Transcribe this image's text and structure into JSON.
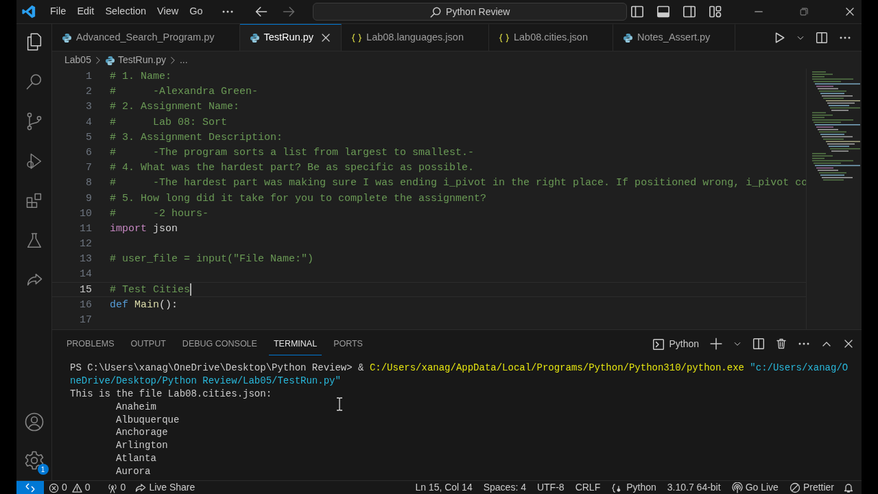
{
  "menu": [
    "File",
    "Edit",
    "Selection",
    "View",
    "Go"
  ],
  "command_center": {
    "text": "Python Review"
  },
  "tabs": [
    {
      "label": "Advanced_Search_Program.py",
      "kind": "python",
      "selected": false
    },
    {
      "label": "TestRun.py",
      "kind": "python",
      "selected": true
    },
    {
      "label": "Lab08.languages.json",
      "kind": "json",
      "selected": false
    },
    {
      "label": "Lab08.cities.json",
      "kind": "json",
      "selected": false
    },
    {
      "label": "Notes_Assert.py",
      "kind": "python",
      "selected": false
    }
  ],
  "breadcrumbs": [
    {
      "text": "Lab05",
      "kind": "folder"
    },
    {
      "text": "TestRun.py",
      "kind": "python"
    },
    {
      "text": "...",
      "kind": "more"
    }
  ],
  "code": [
    {
      "number": "1",
      "current": false,
      "tokens": [
        {
          "text": "# 1. Name:",
          "kind": "comment"
        }
      ]
    },
    {
      "number": "2",
      "current": false,
      "tokens": [
        {
          "text": "#      -Alexandra Green-",
          "kind": "comment"
        }
      ]
    },
    {
      "number": "3",
      "current": false,
      "tokens": [
        {
          "text": "# 2. Assignment Name:",
          "kind": "comment"
        }
      ]
    },
    {
      "number": "4",
      "current": false,
      "tokens": [
        {
          "text": "#      Lab 08: Sort",
          "kind": "comment"
        }
      ]
    },
    {
      "number": "5",
      "current": false,
      "tokens": [
        {
          "text": "# 3. Assignment Description:",
          "kind": "comment"
        }
      ]
    },
    {
      "number": "6",
      "current": false,
      "tokens": [
        {
          "text": "#      -The program sorts a list from largest to smallest.-",
          "kind": "comment"
        }
      ]
    },
    {
      "number": "7",
      "current": false,
      "tokens": [
        {
          "text": "# 4. What was the hardest part? Be as specific as possible.",
          "kind": "comment"
        }
      ]
    },
    {
      "number": "8",
      "current": false,
      "tokens": [
        {
          "text": "#      -The hardest part was making sure I was ending i_pivot in the right place. If positioned wrong, i_pivot co",
          "kind": "comment"
        }
      ]
    },
    {
      "number": "9",
      "current": false,
      "tokens": [
        {
          "text": "# 5. How long did it take for you to complete the assignment?",
          "kind": "comment"
        }
      ]
    },
    {
      "number": "10",
      "current": false,
      "tokens": [
        {
          "text": "#      -2 hours-",
          "kind": "comment"
        }
      ]
    },
    {
      "number": "11",
      "current": false,
      "tokens": [
        {
          "text": "import",
          "kind": "keyword"
        },
        {
          "text": "json",
          "kind": "plain"
        }
      ]
    },
    {
      "number": "12",
      "current": false
    },
    {
      "number": "13",
      "current": false,
      "tokens": [
        {
          "text": "# user_file = input(\"File Name:\")",
          "kind": "comment"
        }
      ]
    },
    {
      "number": "14",
      "current": false
    },
    {
      "number": "15",
      "current": true,
      "tokens": [
        {
          "text": "# Test Cities",
          "kind": "comment"
        }
      ]
    },
    {
      "number": "16",
      "current": false,
      "tokens": [
        {
          "text": "def",
          "kind": "storage"
        },
        {
          "text": "Main",
          "kind": "function"
        },
        {
          "text": "():",
          "kind": "plain"
        }
      ]
    },
    {
      "number": "17",
      "current": false
    }
  ],
  "panel": {
    "tabs": [
      {
        "label": "PROBLEMS",
        "selected": false
      },
      {
        "label": "OUTPUT",
        "selected": false
      },
      {
        "label": "DEBUG CONSOLE",
        "selected": false
      },
      {
        "label": "TERMINAL",
        "selected": true
      },
      {
        "label": "PORTS",
        "selected": false
      }
    ],
    "profile": "Python"
  },
  "terminal": [
    {
      "kind": "output",
      "segments": [
        {
          "text": "PS C:\\Users\\xanag\\OneDrive\\Desktop\\Python Review> &",
          "kind": "plain"
        },
        {
          "text": "C:/Users/xanag/AppData/Local/Programs/Python/Python310/python.exe",
          "kind": "command"
        },
        {
          "text": "\"c:/Users/xanag/O",
          "kind": "string"
        }
      ]
    },
    {
      "kind": "output",
      "segments": [
        {
          "text": "neDrive/Desktop/Python Review/Lab05/TestRun.py\"",
          "kind": "string"
        }
      ]
    },
    {
      "kind": "output",
      "segments": [
        {
          "text": "This is the file Lab08.cities.json:",
          "kind": "plain"
        }
      ]
    },
    {
      "kind": "item",
      "segments": [
        {
          "text": "Anaheim",
          "kind": "plain"
        }
      ]
    },
    {
      "kind": "item",
      "segments": [
        {
          "text": "Albuquerque",
          "kind": "plain"
        }
      ]
    },
    {
      "kind": "item",
      "segments": [
        {
          "text": "Anchorage",
          "kind": "plain"
        }
      ]
    },
    {
      "kind": "item",
      "segments": [
        {
          "text": "Arlington",
          "kind": "plain"
        }
      ]
    },
    {
      "kind": "item",
      "segments": [
        {
          "text": "Atlanta",
          "kind": "plain"
        }
      ]
    },
    {
      "kind": "item",
      "segments": [
        {
          "text": "Aurora",
          "kind": "plain"
        }
      ]
    }
  ],
  "manage_badge": "1",
  "status_left": [
    {
      "kind": "errors",
      "text": "0"
    },
    {
      "kind": "warnings",
      "text": "0"
    },
    {
      "kind": "ports",
      "text": "0"
    },
    {
      "kind": "share",
      "text": "Live Share"
    }
  ],
  "status_right": [
    {
      "kind": "position",
      "text": "Ln 15, Col 14"
    },
    {
      "kind": "indent",
      "text": "Spaces: 4"
    },
    {
      "kind": "encoding",
      "text": "UTF-8"
    },
    {
      "kind": "eol",
      "text": "CRLF"
    },
    {
      "kind": "language",
      "text": "Python"
    },
    {
      "kind": "interpreter",
      "text": "3.10.7 64-bit"
    },
    {
      "kind": "server",
      "text": "Go Live"
    },
    {
      "kind": "formatter",
      "text": "Prettier"
    }
  ]
}
